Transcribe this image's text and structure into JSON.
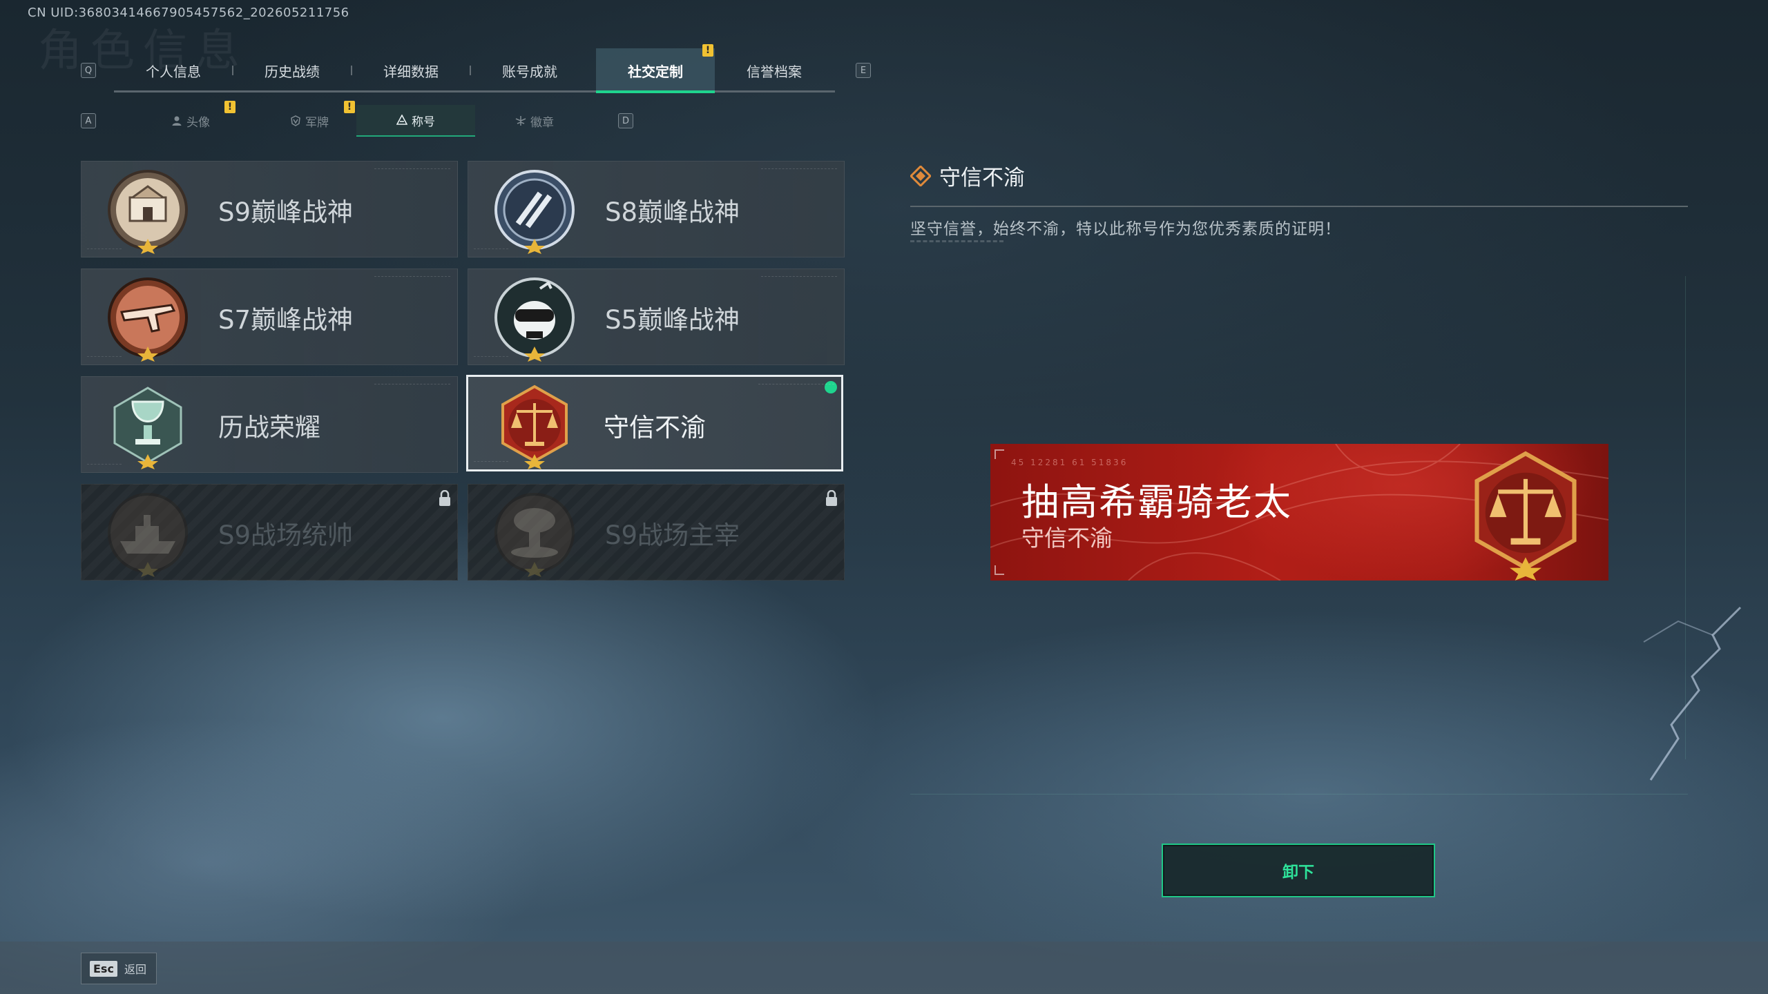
{
  "header": {
    "uid": "CN UID:368034146679054575​62_202605211756",
    "ghost_title": "角色信息"
  },
  "keys": {
    "prev_tab": "Q",
    "next_tab": "E",
    "prev_sub": "A",
    "next_sub": "D"
  },
  "tabs": [
    {
      "label": "个人信息",
      "active": false
    },
    {
      "label": "历史战绩",
      "active": false
    },
    {
      "label": "详细数据",
      "active": false
    },
    {
      "label": "账号成就",
      "active": false
    },
    {
      "label": "社交定制",
      "active": true,
      "alert": "!"
    },
    {
      "label": "信誉档案",
      "active": false
    }
  ],
  "subtabs": [
    {
      "label": "头像",
      "icon": "person-icon",
      "alert": "!"
    },
    {
      "label": "军牌",
      "icon": "dogtag-icon",
      "alert": "!"
    },
    {
      "label": "称号",
      "icon": "title-icon",
      "active": true
    },
    {
      "label": "徽章",
      "icon": "badge-icon"
    }
  ],
  "titles": [
    {
      "label": "S9巅峰战神",
      "icon": "fortress-emblem-icon",
      "state": "normal"
    },
    {
      "label": "S8巅峰战神",
      "icon": "slash-emblem-icon",
      "state": "normal"
    },
    {
      "label": "S7巅峰战神",
      "icon": "gun-emblem-icon",
      "state": "normal"
    },
    {
      "label": "S5巅峰战神",
      "icon": "skull-emblem-icon",
      "state": "normal"
    },
    {
      "label": "历战荣耀",
      "icon": "trophy-emblem-icon",
      "state": "normal"
    },
    {
      "label": "守信不渝",
      "icon": "scales-emblem-icon",
      "state": "selected"
    },
    {
      "label": "S9战场统帅",
      "icon": "ship-emblem-icon",
      "state": "locked"
    },
    {
      "label": "S9战场主宰",
      "icon": "mushroom-cloud-emblem-icon",
      "state": "locked"
    }
  ],
  "detail": {
    "name": "守信不渝",
    "description": "坚守信誉，始终不渝，特以此称号作为您优秀素质的证明！"
  },
  "banner": {
    "player_name": "抽高希霸骑老太",
    "title": "守信不渝",
    "tag": "45 12281  61 51836"
  },
  "actions": {
    "unequip": "卸下"
  },
  "footer": {
    "esc_key": "Esc",
    "back_label": "返回"
  },
  "colors": {
    "accent_green": "#1fd48e",
    "alert_yellow": "#f1c232",
    "banner_red": "#b11e17"
  }
}
